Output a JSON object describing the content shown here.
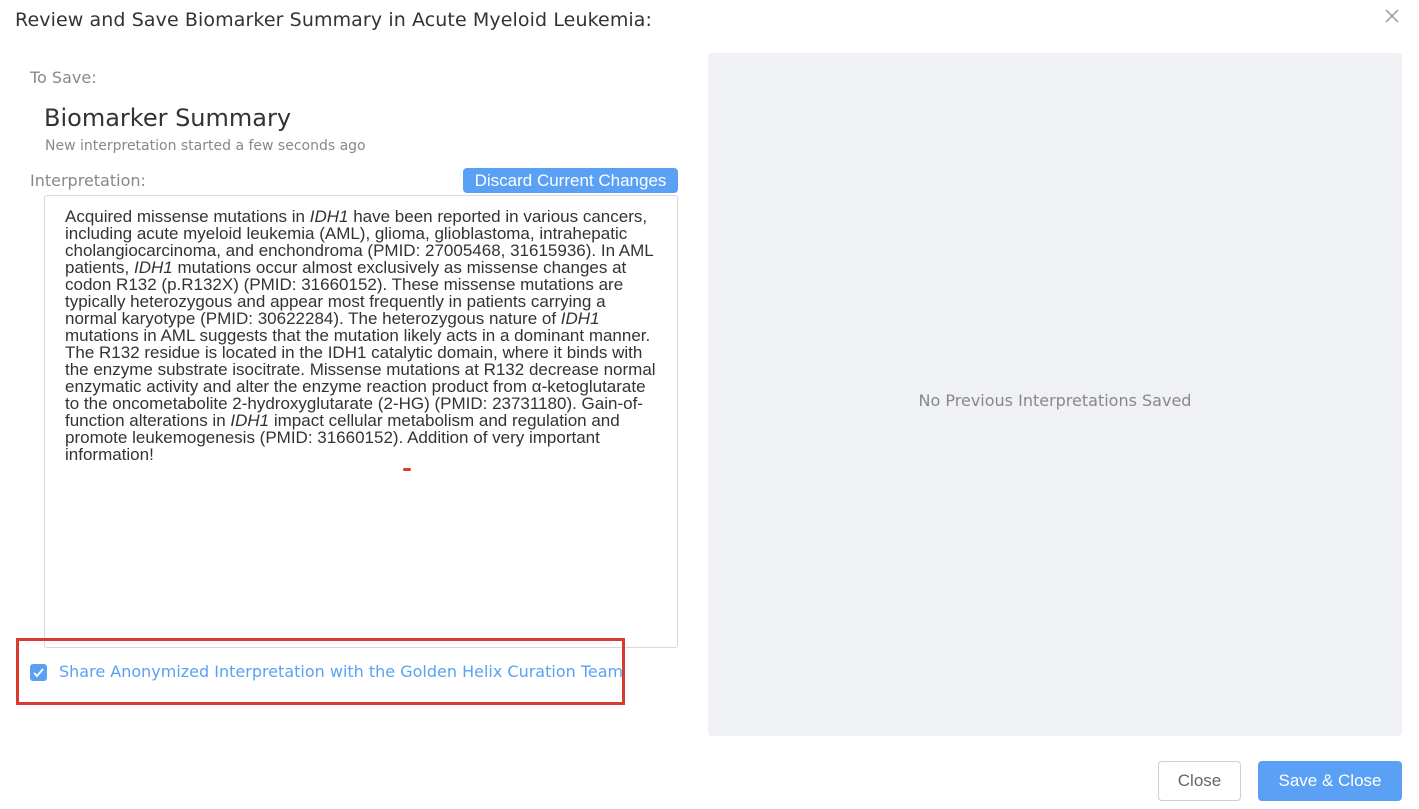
{
  "dialog": {
    "title": "Review and Save Biomarker Summary in Acute Myeloid Leukemia:",
    "close_icon": "close-icon"
  },
  "left": {
    "to_save_label": "To Save:",
    "summary_title": "Biomarker Summary",
    "summary_subtitle": "New interpretation started a few seconds ago",
    "interpretation_label": "Interpretation:",
    "discard_button": "Discard Current Changes",
    "interpretation_parts": [
      "Acquired missense mutations in ",
      "IDH1",
      " have been reported in various cancers, including acute myeloid leukemia (AML), glioma, glioblastoma, intrahepatic cholangiocarcinoma, and enchondroma (PMID: 27005468, 31615936). In AML patients, ",
      "IDH1",
      " mutations occur almost exclusively as missense changes at codon R132 (p.R132X) (PMID: 31660152). These missense mutations are typically heterozygous and appear most frequently in patients carrying a normal karyotype (PMID: 30622284). The heterozygous nature of ",
      "IDH1",
      " mutations in AML suggests that the mutation likely acts in a dominant manner. The R132 residue is located in the IDH1 catalytic domain, where it binds with the enzyme substrate isocitrate. Missense mutations at R132 decrease normal enzymatic activity and alter the enzyme reaction product from α-ketoglutarate to the oncometabolite 2-hydroxyglutarate (2-HG) (PMID: 23731180). Gain-of-function alterations in ",
      "IDH1",
      " impact cellular metabolism and regulation and promote leukemogenesis (PMID: 31660152). ",
      "Addition of very important information!"
    ],
    "share_checkbox_checked": true,
    "share_label": "Share Anonymized Interpretation with the Golden Helix Curation Team"
  },
  "right": {
    "empty_message": "No Previous Interpretations Saved"
  },
  "footer": {
    "close_button": "Close",
    "save_button": "Save & Close"
  },
  "colors": {
    "accent": "#5aa1f5",
    "highlight_red": "#d93a2b",
    "panel_bg": "#f0f1f4"
  }
}
